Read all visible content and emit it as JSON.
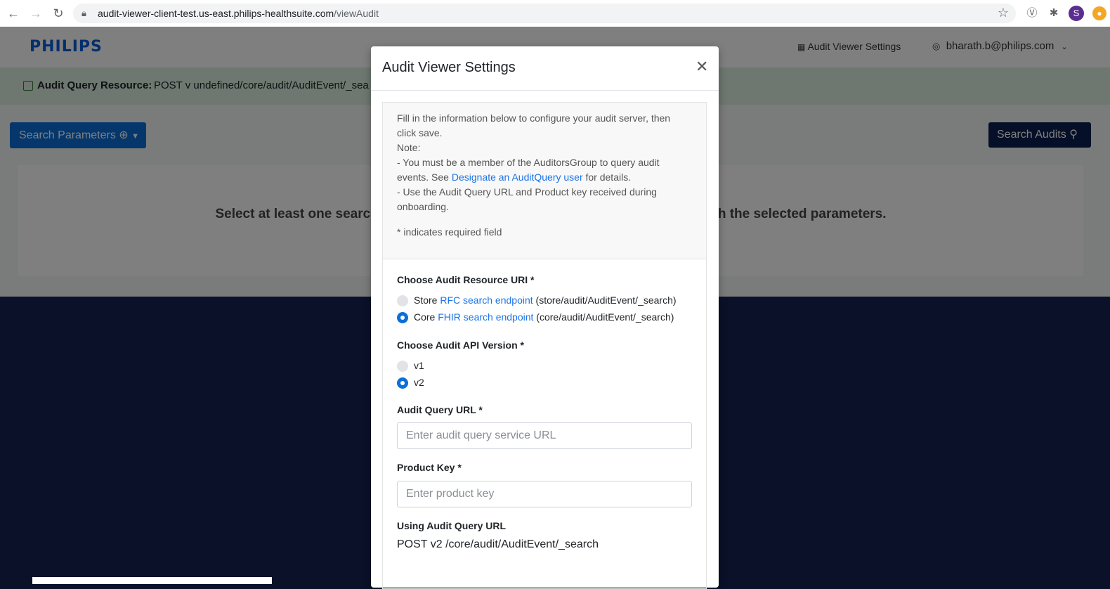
{
  "browser": {
    "url_host": "audit-viewer-client-test.us-east.philips-healthsuite.com",
    "url_path": "/viewAudit",
    "profile_initial": "S"
  },
  "header": {
    "logo": "PHILIPS",
    "settings_link": "Audit Viewer Settings",
    "user_email": "bharath.b@philips.com"
  },
  "resource_bar": {
    "label": "Audit Query Resource:",
    "value": "POST v undefined/core/audit/AuditEvent/_sea"
  },
  "toolbar": {
    "search_params_label": "Search Parameters",
    "search_audits_label": "Search Audits"
  },
  "results": {
    "message_left": "Select at least one search",
    "message_right": "h the selected parameters."
  },
  "modal": {
    "title": "Audit Viewer Settings",
    "info": {
      "line1": "Fill in the information below to configure your audit server, then click save.",
      "note": "Note:",
      "bullet1_pre": "- You must be a member of the AuditorsGroup to query audit events. See ",
      "bullet1_link": "Designate an AuditQuery user",
      "bullet1_post": " for details.",
      "bullet2": "- Use the Audit Query URL and Product key received during onboarding.",
      "required_note": "* indicates required field"
    },
    "resource_uri": {
      "label": "Choose Audit Resource URI *",
      "options": [
        {
          "prefix": "Store ",
          "link": "RFC search endpoint",
          "suffix": " (store/audit/AuditEvent/_search)",
          "selected": false
        },
        {
          "prefix": "Core ",
          "link": "FHIR search endpoint",
          "suffix": " (core/audit/AuditEvent/_search)",
          "selected": true
        }
      ]
    },
    "api_version": {
      "label": "Choose Audit API Version *",
      "options": [
        {
          "label": "v1",
          "selected": false
        },
        {
          "label": "v2",
          "selected": true
        }
      ]
    },
    "query_url": {
      "label": "Audit Query URL *",
      "placeholder": "Enter audit query service URL",
      "value": ""
    },
    "product_key": {
      "label": "Product Key *",
      "placeholder": "Enter product key",
      "value": ""
    },
    "using": {
      "label": "Using Audit Query URL",
      "value": "POST v2 /core/audit/AuditEvent/_search"
    }
  },
  "colors": {
    "primary": "#0b6fd8",
    "navy": "#0b1f4f",
    "resource_bar_bg": "#dcefe0",
    "page_bg_dark": "#0a1128"
  }
}
